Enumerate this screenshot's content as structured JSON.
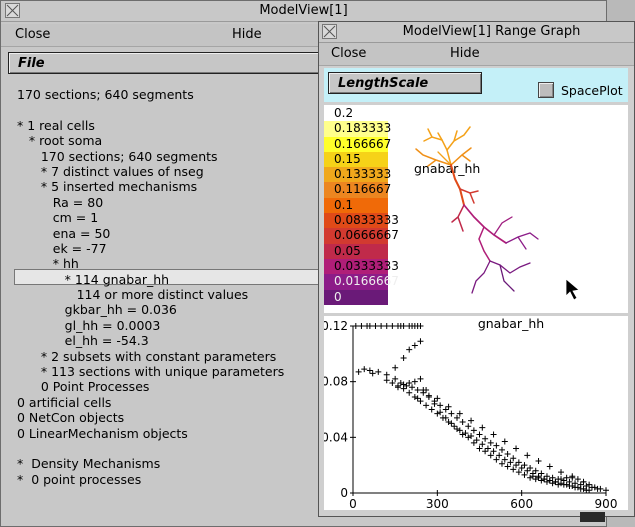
{
  "main_window": {
    "title": "ModelView[1]",
    "menu": {
      "close": "Close",
      "hide": "Hide"
    },
    "file_button": "File",
    "tree": [
      "170 sections; 640 segments",
      "",
      "* 1 real cells",
      "   * root soma",
      "      170 sections; 640 segments",
      "      * 7 distinct values of nseg",
      "      * 5 inserted mechanisms",
      "         Ra = 80",
      "         cm = 1",
      "         ena = 50",
      "         ek = -77",
      "         * hh",
      "            * 114 gnabar_hh",
      "               114 or more distinct values",
      "            gkbar_hh = 0.036",
      "            gl_hh = 0.0003",
      "            el_hh = -54.3",
      "      * 2 subsets with constant parameters",
      "      * 113 sections with unique parameters",
      "      0 Point Processes",
      "0 artificial cells",
      "0 NetCon objects",
      "0 LinearMechanism objects",
      "",
      "*  Density Mechanisms",
      "*  0 point processes"
    ]
  },
  "range_window": {
    "title": "ModelView[1] Range Graph",
    "menu": {
      "close": "Close",
      "hide": "Hide"
    },
    "length_scale_button": "LengthScale",
    "spaceplot_label": "SpacePlot",
    "spaceplot_checked": false,
    "shape_label": "gnabar_hh",
    "colorbar": [
      {
        "label": "0.2",
        "color": "#ffffff"
      },
      {
        "label": "0.183333",
        "color": "#ffff8c"
      },
      {
        "label": "0.166667",
        "color": "#ffff2a"
      },
      {
        "label": "0.15",
        "color": "#f6d218"
      },
      {
        "label": "0.133333",
        "color": "#f0a81c"
      },
      {
        "label": "0.116667",
        "color": "#ec8620"
      },
      {
        "label": "0.1",
        "color": "#f06a08"
      },
      {
        "label": "0.0833333",
        "color": "#e04a18"
      },
      {
        "label": "0.0666667",
        "color": "#d23a30"
      },
      {
        "label": "0.05",
        "color": "#c02a4a"
      },
      {
        "label": "0.0333333",
        "color": "#b01e78"
      },
      {
        "label": "0.0166667",
        "color": "#8c1c88"
      },
      {
        "label": "0",
        "color": "#6a1a78"
      }
    ]
  },
  "chart_data": {
    "type": "scatter",
    "title": "gnabar_hh",
    "xlabel": "",
    "ylabel": "",
    "xlim": [
      0,
      900
    ],
    "ylim": [
      0,
      0.12
    ],
    "x_ticks": [
      "0",
      "300",
      "600",
      "900"
    ],
    "y_ticks": [
      "0",
      "0.04",
      "0.08",
      "0.12"
    ],
    "series": [
      {
        "marker": "+",
        "x": [
          10,
          30,
          50,
          60,
          80,
          100,
          120,
          140,
          160,
          170,
          180,
          200,
          210,
          220,
          230,
          240,
          20,
          40,
          60,
          70,
          90,
          120,
          150,
          180,
          200,
          220,
          240,
          150,
          170,
          190,
          210,
          230,
          250,
          270,
          290,
          310,
          330,
          350,
          370,
          390,
          410,
          430,
          450,
          470,
          490,
          510,
          530,
          550,
          570,
          590,
          610,
          630,
          650,
          670,
          690,
          710,
          730,
          750,
          770,
          790,
          810,
          830,
          850,
          870,
          120,
          140,
          160,
          180,
          200,
          220,
          240,
          260,
          280,
          300,
          320,
          340,
          360,
          380,
          400,
          420,
          440,
          460,
          480,
          500,
          520,
          540,
          560,
          580,
          600,
          620,
          640,
          660,
          680,
          700,
          720,
          740,
          760,
          780,
          800,
          820,
          840,
          260,
          300,
          340,
          380,
          420,
          460,
          500,
          540,
          580,
          620,
          660,
          700,
          740,
          780,
          820,
          160,
          180,
          200,
          220,
          240,
          230,
          250,
          270,
          290,
          310,
          330,
          350,
          370,
          390,
          410,
          430,
          450,
          470,
          490,
          510,
          530,
          550,
          570,
          590,
          610,
          630,
          650,
          670,
          690,
          710,
          730,
          750,
          770,
          790,
          810,
          830,
          640,
          660,
          680,
          700,
          720,
          740,
          760,
          780,
          800,
          820,
          840,
          860,
          880,
          900
        ],
        "y": [
          0.12,
          0.12,
          0.12,
          0.12,
          0.12,
          0.12,
          0.12,
          0.12,
          0.12,
          0.12,
          0.12,
          0.12,
          0.12,
          0.12,
          0.12,
          0.12,
          0.087,
          0.089,
          0.088,
          0.086,
          0.087,
          0.085,
          0.09,
          0.097,
          0.103,
          0.106,
          0.109,
          0.082,
          0.079,
          0.077,
          0.076,
          0.074,
          0.072,
          0.069,
          0.066,
          0.063,
          0.06,
          0.057,
          0.054,
          0.051,
          0.048,
          0.045,
          0.042,
          0.039,
          0.036,
          0.034,
          0.031,
          0.028,
          0.025,
          0.022,
          0.02,
          0.018,
          0.016,
          0.014,
          0.012,
          0.011,
          0.01,
          0.009,
          0.008,
          0.007,
          0.006,
          0.005,
          0.004,
          0.003,
          0.081,
          0.079,
          0.077,
          0.075,
          0.072,
          0.069,
          0.066,
          0.063,
          0.06,
          0.057,
          0.054,
          0.051,
          0.048,
          0.045,
          0.043,
          0.041,
          0.038,
          0.035,
          0.032,
          0.03,
          0.027,
          0.024,
          0.022,
          0.02,
          0.018,
          0.016,
          0.014,
          0.012,
          0.01,
          0.009,
          0.008,
          0.007,
          0.006,
          0.005,
          0.004,
          0.003,
          0.002,
          0.074,
          0.068,
          0.062,
          0.057,
          0.052,
          0.047,
          0.042,
          0.037,
          0.032,
          0.027,
          0.023,
          0.019,
          0.015,
          0.011,
          0.008,
          0.076,
          0.078,
          0.079,
          0.08,
          0.082,
          0.068,
          0.074,
          0.07,
          0.064,
          0.058,
          0.054,
          0.05,
          0.046,
          0.042,
          0.04,
          0.036,
          0.032,
          0.03,
          0.027,
          0.024,
          0.021,
          0.019,
          0.017,
          0.015,
          0.013,
          0.011,
          0.01,
          0.009,
          0.008,
          0.007,
          0.006,
          0.006,
          0.005,
          0.004,
          0.003,
          0.002,
          0.012,
          0.011,
          0.01,
          0.009,
          0.008,
          0.01,
          0.011,
          0.012,
          0.01,
          0.008,
          0.006,
          0.004,
          0.003,
          0.002
        ]
      }
    ]
  }
}
